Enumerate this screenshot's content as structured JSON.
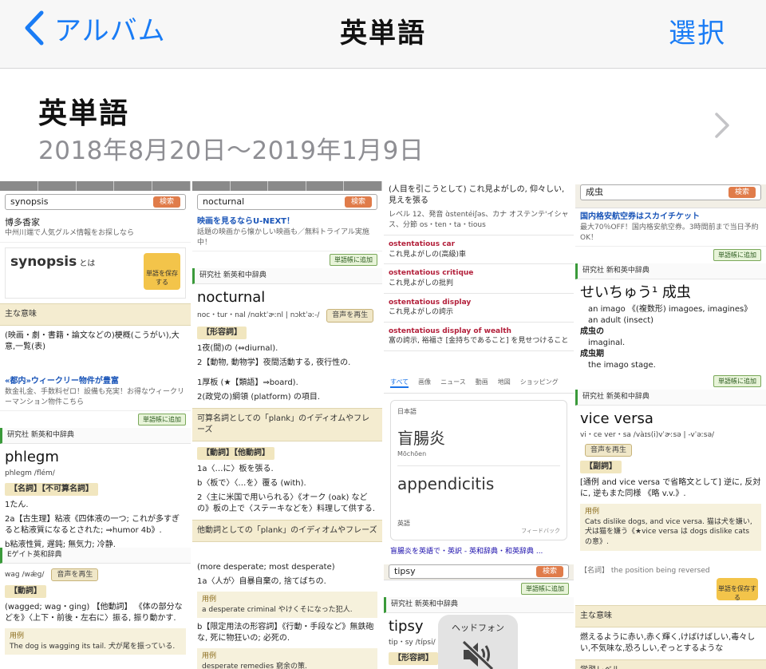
{
  "nav": {
    "back_label": "アルバム",
    "title": "英単語",
    "select_label": "選択"
  },
  "album": {
    "title": "英単語",
    "date_range": "2018年8月20日〜2019年1月9日"
  },
  "thumbs": {
    "t1": {
      "search": "synopsis",
      "search_btn": "検索",
      "ad_title": "博多香家",
      "ad_text": "中州川端で人気グルメ情報をお探しなら",
      "word": "synopsis",
      "word_suffix": "とは",
      "save_label": "単語を保存する",
      "meaning_head": "主な意味",
      "meaning": "(映画・劇・書籍・論文などの)梗概(こうがい),大意,一覧(表)"
    },
    "t2": {
      "search": "nocturnal",
      "search_btn": "検索",
      "ad": "映画を見るならU-NEXT！",
      "ad_sub": "話題の映画から懐かしい映画も／無料トライアル実施中！",
      "add": "単語帳に追加",
      "source": "研究社 新英和中辞典",
      "word": "nocturnal",
      "pron": "noc・tur・nal /nɑktˈɚːnl | nɔktˈəː-/",
      "audio": "音声を再生",
      "pos": "【形容詞】",
      "def1": "1夜(間)の (⇔diurnal).",
      "def2": "2【動物, 動物学】夜間活動する, 夜行性の."
    },
    "t3": {
      "head": "(人目を引こうとして) これ見よがしの, 仰々しい, 見えを張る",
      "pron": "レベル 12、発音 ɑ̀stentéiʃəs、カナ オステンテ'イシャス、分節 os・ten・ta・tious",
      "p1_en": "ostentatious car",
      "p1_ja": "これ見よがしの(高級)車",
      "p2_en": "ostentatious critique",
      "p2_ja": "これ見よがしの批判",
      "p3_en": "ostentatious display",
      "p3_ja": "これ見よがしの誇示",
      "p4_en": "ostentatious display of wealth",
      "p4_ja": "富の誇示, 裕福さ [金持ちであること] を見せつけること"
    },
    "t4": {
      "search": "成虫",
      "search_btn": "検索",
      "ad": "国内格安航空券はスカイチケット",
      "ad_sub": "最大70％OFF！国内格安航空券。3時間前まで当日予約OK！",
      "add": "単語帳に追加",
      "source": "研究社 新和英中辞典",
      "word": "せいちゅう¹ 成虫",
      "l1": "an imago 《(複数形) imagoes, imagines》",
      "l2": "an adult (insect)",
      "h1": "成虫の",
      "l3": "imaginal.",
      "h2": "成虫期",
      "l4": "the imago stage."
    },
    "t5": {
      "ad": "«都内»ウィークリー物件が豊富",
      "ad_sub": "数金礼金、手数料ゼロ！設備も充実！お得なウィークリーマンション物件こちら",
      "add": "単語帳に追加",
      "source": "研究社 新英和中辞典",
      "word": "phlegm",
      "pron": "phlegm /flém/",
      "pos": "【名詞】【不可算名詞】",
      "def1": "1たん.",
      "def2": "2a【古生理】粘液《四体液の一つ; これが多すぎると粘液質になるとされた; ⇒humor 4b》.",
      "def3": "b粘液性質, 遅鈍; 無気力; 冷静."
    },
    "t6": {
      "def1": "1厚板 (★【類語】⇒board).",
      "def2": "2(政党の)綱領 (platform) の項目.",
      "sec1": "可算名詞としての「plank」のイディオムやフレーズ",
      "pos": "【動詞】【他動詞】",
      "v1": "1a〈…に〉板を張る.",
      "v2": "b〈板で〉〈…を〉覆る (with).",
      "v3": "2〈主に米国で用いられる〉《オーク (oak) などの》板の上で〈ステーキなどを〉料理して供する.",
      "sec2": "他動詞としての「plank」のイディオムやフレーズ"
    },
    "t7": {
      "tabs": [
        "すべて",
        "画像",
        "ニュース",
        "動画",
        "地図",
        "ショッピング"
      ],
      "src_lang": "日本語",
      "src_text": "盲腸炎",
      "romaji": "Mōchōen",
      "dst_text": "appendicitis",
      "dst_lang": "英語",
      "feedback": "フィードバック",
      "link": "盲腸炎を英語で・英訳 - 英和辞典・和英辞典 ..."
    },
    "t8": {
      "add": "単語帳に追加",
      "source": "研究社 新英和中辞典",
      "word": "vice versa",
      "pron": "vi・ce ver・sa /vàɪs(i)vˈɚːsə | -vˈəːsə/",
      "audio": "音声を再生",
      "pos": "【副詞】",
      "def": "[通例 and vice versa で省略文として] 逆に, 反対に, 逆もまた同様 《略 v.v.》.",
      "ex_head": "用例",
      "ex": "Cats dislike dogs, and vice versa. 猫は犬を嫌い, 犬は猫を嫌う《★vice versa は dogs dislike cats の意》."
    },
    "t9": {
      "source": "Eゲイト英和辞典",
      "pron": "wag /wǽg/",
      "audio": "音声を再生",
      "pos": "【動詞】",
      "def": "(wagged; wag・ging) 【他動詞】 《体の部分などを》〈上下・前後・左右に〉振る, 振り動かす.",
      "ex_head": "用例",
      "ex": "The dog is wagging its tail. 犬が尾を振っている."
    },
    "t10": {
      "head": "(more desperate; most desperate)",
      "def1": "1a〈人が〉自暴自棄の, 捨てばちの.",
      "ex_head": "用例",
      "ex1": "a desperate criminal やけくそになった犯人.",
      "def2": "b【限定用法の形容詞】《行動・手段など》無鉄砲な, 死に物狂いの; 必死の.",
      "ex2_head": "用例",
      "ex2": "desperate remedies 窮余の策."
    },
    "t11": {
      "search": "tipsy",
      "search_btn": "検索",
      "add": "単語帳に追加",
      "source": "研究社 新英和中辞典",
      "word": "tipsy",
      "pron": "tip・sy /típsi/",
      "pos": "【形容詞】"
    },
    "t12": {
      "top": "【名詞】 the position being reversed",
      "save_label": "単語を保存する",
      "meaning_head": "主な意味",
      "meaning": "燃えるように赤い,赤く輝く,けばけばしい,毒々しい,不気味な,恐ろしい,ぞっとするような",
      "level": "学習レベル"
    }
  },
  "hud": {
    "title": "ヘッドフォン"
  },
  "colors": {
    "ios_blue": "#1a7cf5",
    "secondary_gray": "#8e8e93"
  }
}
